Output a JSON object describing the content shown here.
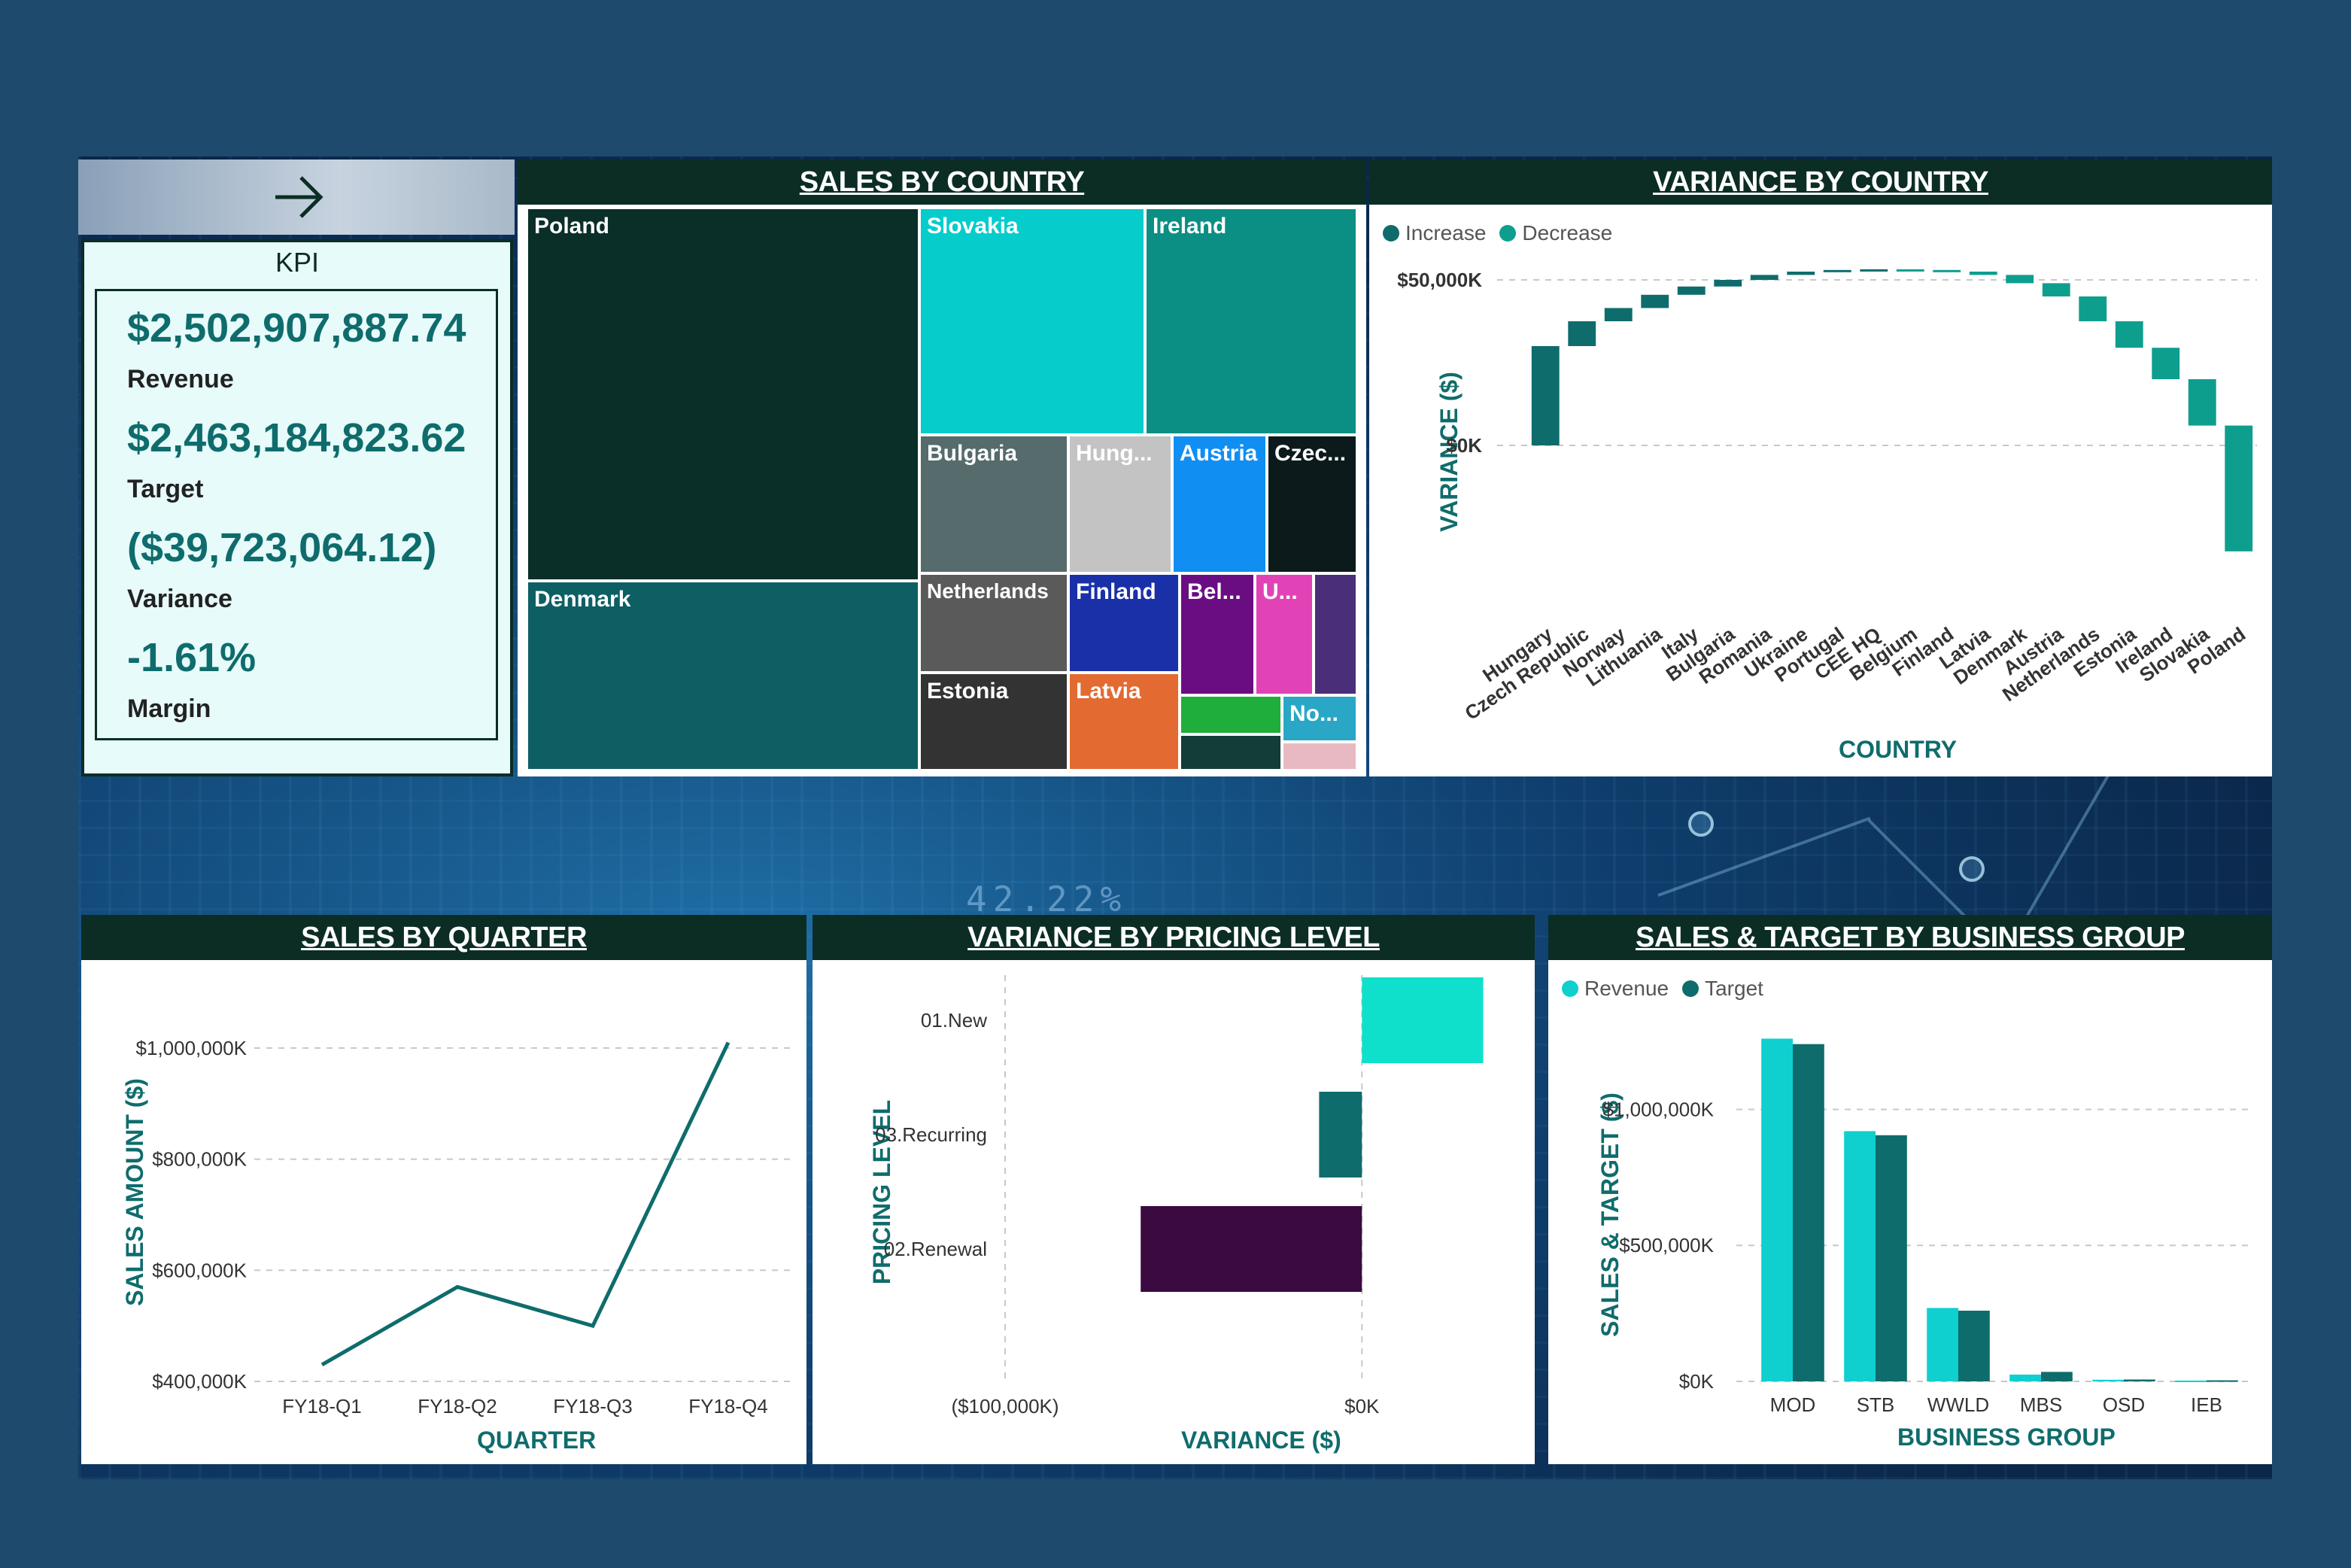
{
  "nav": {
    "arrow_icon": "arrow-right-icon"
  },
  "kpi": {
    "title": "KPI",
    "revenue_value": "$2,502,907,887.74",
    "revenue_label": "Revenue",
    "target_value": "$2,463,184,823.62",
    "target_label": "Target",
    "variance_value": "($39,723,064.12)",
    "variance_label": "Variance",
    "margin_value": "-1.61%",
    "margin_label": "Margin"
  },
  "background": {
    "decor_text": "42.22%"
  },
  "colors": {
    "header": "#0b2d24",
    "teal_dark": "#0f6c6c",
    "teal_light": "#0fcfcf",
    "increase": "#0f6c6c",
    "decrease": "#0e9e8e"
  },
  "sales_by_country": {
    "title": "SALES BY COUNTRY",
    "chart_data": {
      "type": "treemap",
      "labels": [
        "Poland",
        "Denmark",
        "Slovakia",
        "Ireland",
        "Bulgaria",
        "Hung...",
        "Austria",
        "Czec...",
        "Netherlands",
        "Finland",
        "Bel...",
        "U...",
        "Estonia",
        "Latvia",
        "No..."
      ],
      "colors": {
        "Poland": "#0a2e28",
        "Denmark": "#0d5f63",
        "Slovakia": "#06cccc",
        "Ireland": "#0b8f84",
        "Bulgaria": "#566b6b",
        "Hung...": "#c3c3c3",
        "Austria": "#118ef2",
        "Czec...": "#0c1a1c",
        "Netherlands": "#5a5a5a",
        "Finland": "#1930a8",
        "Bel...": "#6b0d82",
        "U...": "#e143b6",
        "Estonia": "#333333",
        "Latvia": "#e36a31",
        "No...": "#2aa6c6"
      }
    }
  },
  "variance_by_country": {
    "title": "VARIANCE BY COUNTRY",
    "legend": [
      "Increase",
      "Decrease"
    ],
    "chart_data": {
      "type": "waterfall",
      "categories": [
        "Hungary",
        "Czech Republic",
        "Norway",
        "Lithuania",
        "Italy",
        "Bulgaria",
        "Romania",
        "Ukraine",
        "Portugal",
        "CEE HQ",
        "Belgium",
        "Finland",
        "Latvia",
        "Denmark",
        "Austria",
        "Netherlands",
        "Estonia",
        "Ireland",
        "Slovakia",
        "Poland"
      ],
      "changes": [
        30000,
        7500,
        4000,
        4000,
        2500,
        2000,
        1500,
        1000,
        500,
        200,
        -200,
        -500,
        -1000,
        -2500,
        -4000,
        -7500,
        -8000,
        -9500,
        -14000,
        -38000
      ],
      "ylim": [
        -42000,
        58000
      ],
      "yticks": [
        0,
        50000
      ],
      "ytick_labels": [
        "$0K",
        "$50,000K"
      ],
      "xlabel": "COUNTRY",
      "ylabel": "VARIANCE ($)"
    }
  },
  "sales_by_quarter": {
    "title": "SALES BY QUARTER",
    "chart_data": {
      "type": "line",
      "categories": [
        "FY18-Q1",
        "FY18-Q2",
        "FY18-Q3",
        "FY18-Q4"
      ],
      "values": [
        430000,
        570000,
        500000,
        1010000
      ],
      "ylim": [
        400000,
        1050000
      ],
      "yticks": [
        400000,
        600000,
        800000,
        1000000
      ],
      "ytick_labels": [
        "$400,000K",
        "$600,000K",
        "$800,000K",
        "$1,000,000K"
      ],
      "xlabel": "QUARTER",
      "ylabel": "SALES AMOUNT ($)"
    }
  },
  "variance_by_pricing": {
    "title": "VARIANCE BY PRICING LEVEL",
    "chart_data": {
      "type": "bar",
      "categories": [
        "01.New",
        "03.Recurring",
        "02.Renewal"
      ],
      "values": [
        34000,
        -12000,
        -62000
      ],
      "colors": [
        "#0fe0cc",
        "#0f6c6c",
        "#3a0a40"
      ],
      "xlim": [
        -100000,
        40000
      ],
      "xticks": [
        -100000,
        0
      ],
      "xtick_labels": [
        "($100,000K)",
        "$0K"
      ],
      "xlabel": "VARIANCE ($)",
      "ylabel": "PRICING LEVEL"
    }
  },
  "sales_target_by_group": {
    "title": "SALES & TARGET BY BUSINESS GROUP",
    "legend": [
      "Revenue",
      "Target"
    ],
    "chart_data": {
      "type": "bar",
      "categories": [
        "MOD",
        "STB",
        "WWLD",
        "MBS",
        "OSD",
        "IEB"
      ],
      "series": [
        {
          "name": "Revenue",
          "values": [
            1260000,
            920000,
            270000,
            25000,
            6000,
            3000
          ]
        },
        {
          "name": "Target",
          "values": [
            1240000,
            905000,
            260000,
            35000,
            7000,
            4000
          ]
        }
      ],
      "ylim": [
        0,
        1300000
      ],
      "yticks": [
        0,
        500000,
        1000000
      ],
      "ytick_labels": [
        "$0K",
        "$500,000K",
        "$1,000,000K"
      ],
      "xlabel": "BUSINESS GROUP",
      "ylabel": "SALES & TARGET ($)"
    }
  }
}
